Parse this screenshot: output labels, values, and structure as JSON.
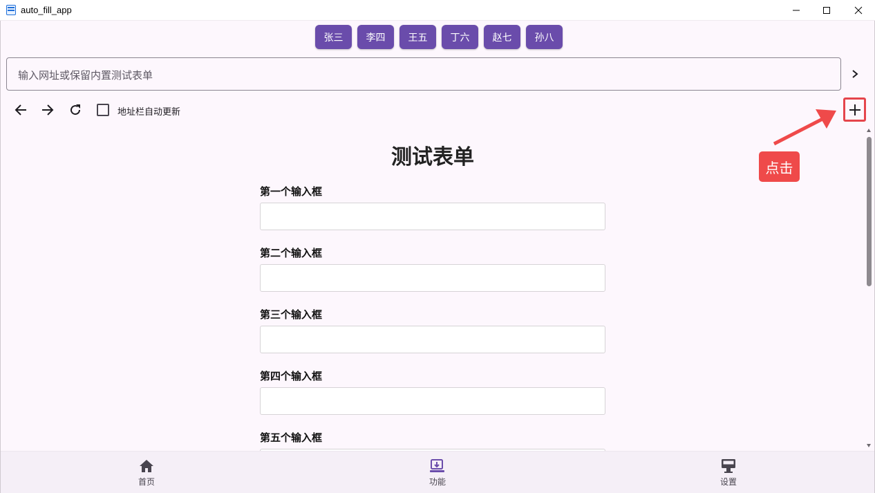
{
  "window": {
    "title": "auto_fill_app",
    "icon": "app-window-icon",
    "controls": [
      "minimize-icon",
      "maximize-icon",
      "close-icon"
    ]
  },
  "chips": [
    "张三",
    "李四",
    "王五",
    "丁六",
    "赵七",
    "孙八"
  ],
  "address_bar": {
    "placeholder": "输入网址或保留内置测试表单",
    "go_icon": "chevron-right-icon"
  },
  "toolbar": {
    "back_icon": "arrow-left-icon",
    "forward_icon": "arrow-right-icon",
    "reload_icon": "refresh-icon",
    "auto_update_label": "地址栏自动更新",
    "auto_update_checked": false,
    "add_icon": "plus-icon"
  },
  "annotation": {
    "callout_text": "点击",
    "color": "#ef4a4a"
  },
  "form": {
    "title": "测试表单",
    "fields": [
      {
        "label": "第一个输入框",
        "value": ""
      },
      {
        "label": "第二个输入框",
        "value": ""
      },
      {
        "label": "第三个输入框",
        "value": ""
      },
      {
        "label": "第四个输入框",
        "value": ""
      },
      {
        "label": "第五个输入框",
        "value": ""
      }
    ]
  },
  "bottom_nav": {
    "items": [
      {
        "label": "首页",
        "icon": "home-icon"
      },
      {
        "label": "功能",
        "icon": "function-icon",
        "active": true
      },
      {
        "label": "设置",
        "icon": "settings-monitor-icon"
      }
    ]
  },
  "colors": {
    "chip": "#6a4cab",
    "background": "#fdf7fd",
    "bottom_nav": "#f5eff7",
    "active_icon": "#6a4cab"
  }
}
